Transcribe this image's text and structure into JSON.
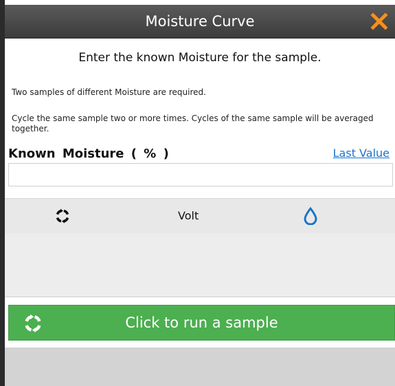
{
  "window": {
    "title": "Moisture Curve",
    "close_icon": "close-icon",
    "accent_color": "#f5901e"
  },
  "instructions": {
    "prompt": "Enter the known Moisture for the sample.",
    "note1": "Two samples of different Moisture are required.",
    "note2": "Cycle the same sample two or more times. Cycles of the same sample will be averaged together."
  },
  "field": {
    "label": "Known  Moisture  ( % )",
    "last_value_link": "Last Value",
    "value": "",
    "placeholder": ""
  },
  "table": {
    "columns": [
      {
        "icon": "cycle-icon"
      },
      {
        "label": "Volt"
      },
      {
        "icon": "water-drop-icon"
      }
    ],
    "rows": []
  },
  "run_button": {
    "label": "Click to run a sample",
    "icon": "cycle-icon",
    "color": "#4caf50"
  }
}
